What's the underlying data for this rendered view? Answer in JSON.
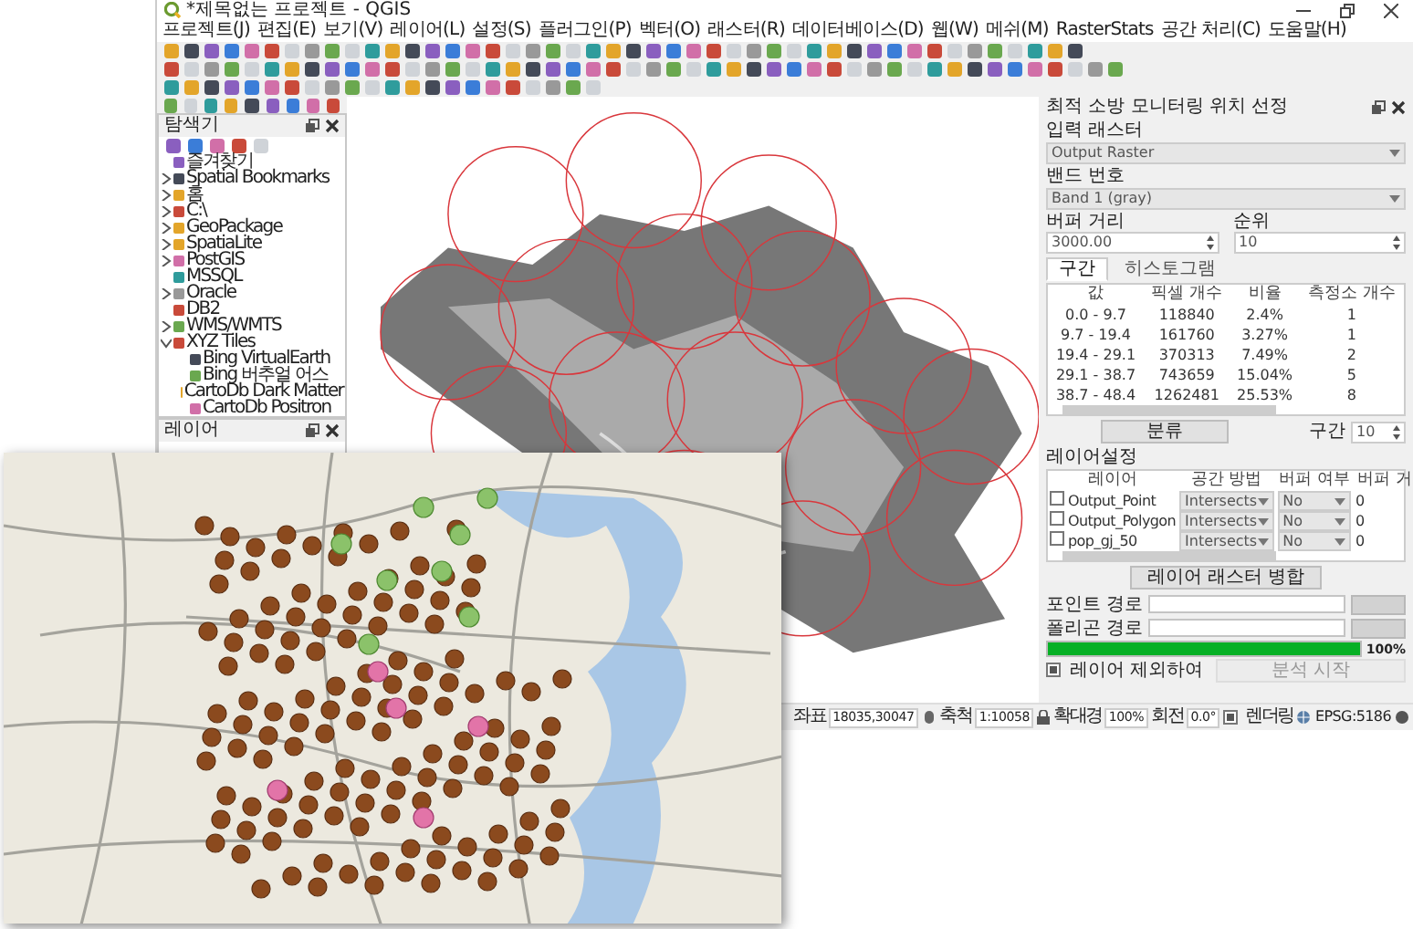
{
  "window": {
    "title": "*제목없는 프로젝트 - QGIS"
  },
  "menu": [
    "프로젝트(J)",
    "편집(E)",
    "보기(V)",
    "레이어(L)",
    "설정(S)",
    "플러그인(P)",
    "벡터(O)",
    "래스터(R)",
    "데이터베이스(D)",
    "웹(W)",
    "메쉬(M)",
    "RasterStats",
    "공간 처리(C)",
    "도움말(H)"
  ],
  "browser_panel": {
    "title": "탐색기",
    "items": [
      {
        "label": "즐겨찾기"
      },
      {
        "label": "Spatial Bookmarks",
        "expanded": false
      },
      {
        "label": "홈",
        "expanded": false
      },
      {
        "label": "C:\\",
        "expanded": false
      },
      {
        "label": "GeoPackage",
        "expanded": false
      },
      {
        "label": "SpatiaLite",
        "expanded": false
      },
      {
        "label": "PostGIS",
        "expanded": false
      },
      {
        "label": "MSSQL"
      },
      {
        "label": "Oracle",
        "expanded": false
      },
      {
        "label": "DB2"
      },
      {
        "label": "WMS/WMTS",
        "expanded": false
      },
      {
        "label": "XYZ Tiles",
        "expanded": true,
        "children": [
          {
            "label": "Bing VirtualEarth"
          },
          {
            "label": "Bing 버추얼 어스"
          },
          {
            "label": "CartoDb Dark Matter"
          },
          {
            "label": "CartoDb Positron"
          }
        ]
      }
    ]
  },
  "layers_panel": {
    "title": "레이어"
  },
  "analysis_panel": {
    "title": "최적 소방 모니터링 위치 선정",
    "input_raster": {
      "label": "입력 래스터",
      "value": "Output Raster"
    },
    "band": {
      "label": "밴드 번호",
      "value": "Band 1 (gray)"
    },
    "buffer_distance": {
      "label": "버퍼 거리",
      "value": "3000.00"
    },
    "rank": {
      "label": "순위",
      "value": "10"
    },
    "tabs": [
      {
        "label": "구간",
        "selected": true
      },
      {
        "label": "히스토그램",
        "selected": false
      }
    ],
    "class_table": {
      "columns": [
        "값",
        "픽셀 개수",
        "비율",
        "측정소 개수"
      ],
      "rows": [
        [
          "0.0 - 9.7",
          "118840",
          "2.4%",
          "1"
        ],
        [
          "9.7 - 19.4",
          "161760",
          "3.27%",
          "1"
        ],
        [
          "19.4 - 29.1",
          "370313",
          "7.49%",
          "2"
        ],
        [
          "29.1 - 38.7",
          "743659",
          "15.04%",
          "5"
        ],
        [
          "38.7 - 48.4",
          "1262481",
          "25.53%",
          "8"
        ]
      ]
    },
    "classify_button": "분류",
    "interval": {
      "label": "구간",
      "value": "10"
    },
    "layer_settings": {
      "title": "레이어설정",
      "columns": [
        "레이어",
        "공간 방법",
        "버퍼 여부",
        "버퍼 거"
      ],
      "rows": [
        {
          "checked": false,
          "layer": "Output_Point",
          "method": "Intersects",
          "buffer": "No",
          "distance": "0"
        },
        {
          "checked": false,
          "layer": "Output_Polygon",
          "method": "Intersects",
          "buffer": "No",
          "distance": "0"
        },
        {
          "checked": false,
          "layer": "pop_gj_50",
          "method": "Intersects",
          "buffer": "No",
          "distance": "0"
        }
      ]
    },
    "merge_button": "레이어 래스터 병합",
    "paths": [
      {
        "label": "포인트 경로"
      },
      {
        "label": "폴리곤 경로"
      }
    ],
    "progress": {
      "level": 1,
      "reading": "100%"
    },
    "exclude": {
      "label": "레이어 제외하여",
      "checked": true
    },
    "start_button": {
      "label": "분석 시작",
      "disabled": true
    }
  },
  "status_bar": {
    "coordinate": {
      "label": "좌표",
      "value": "18035,30047"
    },
    "scale": {
      "label": "축척",
      "value": "1:10058"
    },
    "magnifier": {
      "label": "확대경",
      "value": "100%"
    },
    "rotation": {
      "label": "회전",
      "value": "0.0°"
    },
    "render": {
      "label": "렌더링",
      "checked": true
    },
    "crs": "EPSG:5186"
  }
}
